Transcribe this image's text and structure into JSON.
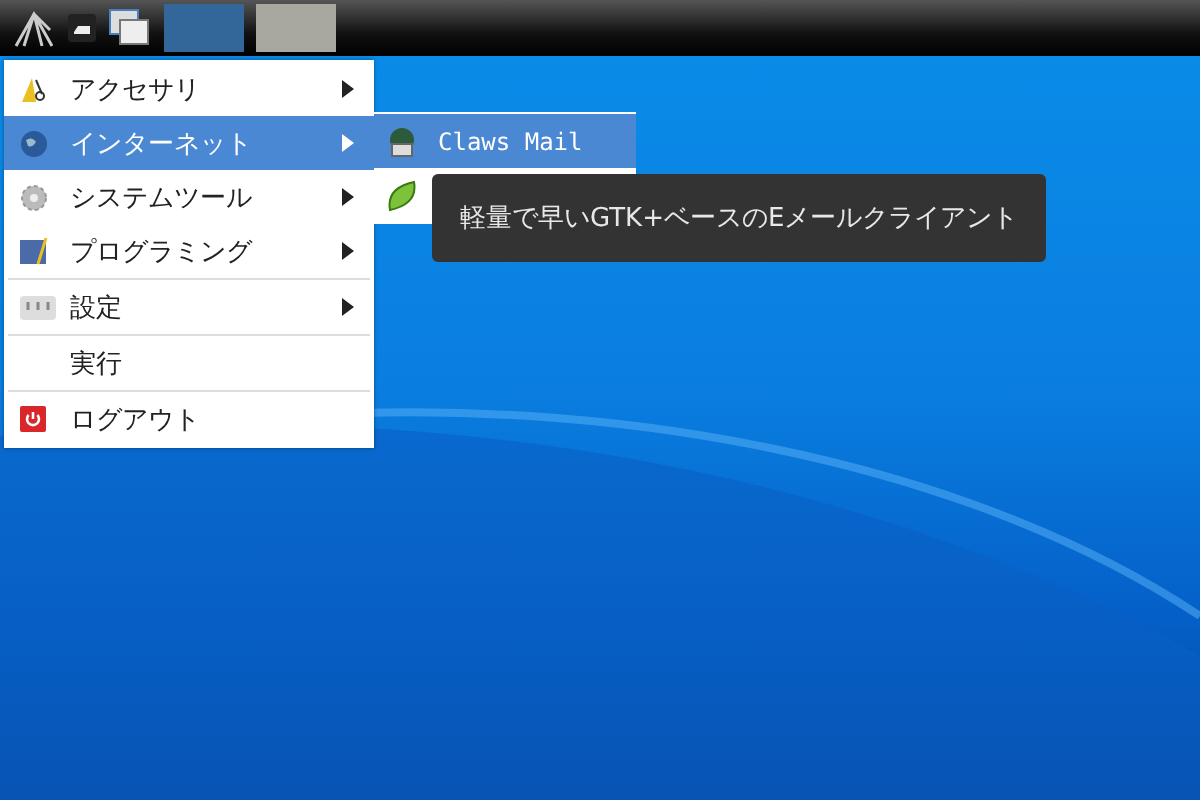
{
  "panel": {
    "tasks": [
      {
        "selected": true
      },
      {
        "selected": false
      }
    ]
  },
  "menu": {
    "items": [
      {
        "label": "アクセサリ",
        "selected": false,
        "has_submenu": true,
        "separator_before": false
      },
      {
        "label": "インターネット",
        "selected": true,
        "has_submenu": true,
        "separator_before": false
      },
      {
        "label": "システムツール",
        "selected": false,
        "has_submenu": true,
        "separator_before": false
      },
      {
        "label": "プログラミング",
        "selected": false,
        "has_submenu": true,
        "separator_before": false
      },
      {
        "label": "設定",
        "selected": false,
        "has_submenu": true,
        "separator_before": true
      },
      {
        "label": "実行",
        "selected": false,
        "has_submenu": false,
        "separator_before": true
      },
      {
        "label": "ログアウト",
        "selected": false,
        "has_submenu": false,
        "separator_before": true
      }
    ]
  },
  "submenu": {
    "items": [
      {
        "label": "Claws Mail",
        "selected": true
      },
      {
        "selected": false
      }
    ]
  },
  "tooltip": {
    "text": "軽量で早いGTK+ベースのEメールクライアント"
  }
}
